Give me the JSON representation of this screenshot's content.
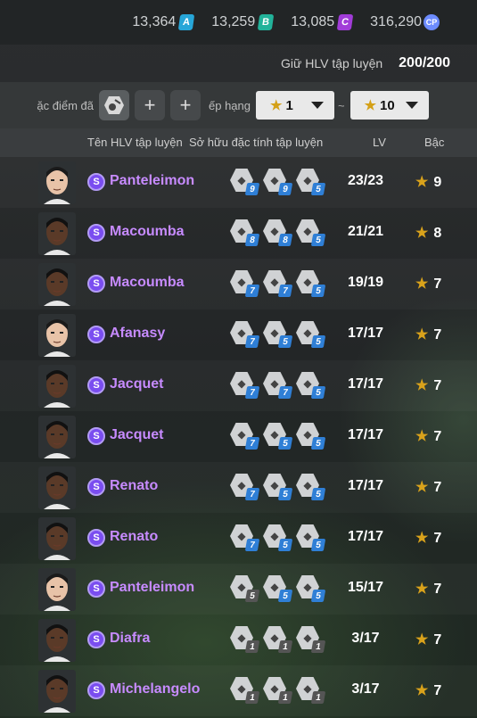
{
  "currencies": [
    {
      "value": "13,364",
      "badge": "A",
      "color": "#27a6d8",
      "icon": "a-coin-icon"
    },
    {
      "value": "13,259",
      "badge": "B",
      "color": "#22b39a",
      "icon": "b-coin-icon"
    },
    {
      "value": "13,085",
      "badge": "C",
      "color": "#a13cd8",
      "icon": "c-coin-icon"
    },
    {
      "value": "316,290",
      "badge": "CP",
      "color": "#6d8cff",
      "icon": "cp-coin-icon"
    }
  ],
  "coach_slots": {
    "label": "Giữ HLV tập luyện",
    "value": "200/200"
  },
  "filter": {
    "trait_label": "ặc điểm đã",
    "rank_label": "ếp hạng",
    "rank_from": "1",
    "rank_to": "10",
    "separator": "~"
  },
  "columns": {
    "name": "Tên HLV tập luyện",
    "traits": "Sở hữu đặc tính tập luyện",
    "lv": "LV",
    "rank": "Bậc"
  },
  "rows": [
    {
      "name": "Panteleimon",
      "face": "light",
      "lv": "23/23",
      "rank": "9",
      "traits": [
        {
          "icon": "shoot-trait-icon",
          "n": "9",
          "c": "#2f7fd6"
        },
        {
          "icon": "pass-trait-icon",
          "n": "9",
          "c": "#2f7fd6"
        },
        {
          "icon": "dribble-trait-icon",
          "n": "5",
          "c": "#2f7fd6"
        }
      ]
    },
    {
      "name": "Macoumba",
      "face": "dark",
      "lv": "21/21",
      "rank": "8",
      "traits": [
        {
          "icon": "keeper-trait-icon",
          "n": "8",
          "c": "#2f7fd6"
        },
        {
          "icon": "pass-trait-icon",
          "n": "8",
          "c": "#2f7fd6"
        },
        {
          "icon": "dribble-trait-icon",
          "n": "5",
          "c": "#2f7fd6"
        }
      ]
    },
    {
      "name": "Macoumba",
      "face": "dark",
      "lv": "19/19",
      "rank": "7",
      "traits": [
        {
          "icon": "defend-trait-icon",
          "n": "7",
          "c": "#2f7fd6"
        },
        {
          "icon": "pass-trait-icon",
          "n": "7",
          "c": "#2f7fd6"
        },
        {
          "icon": "dribble-trait-icon",
          "n": "5",
          "c": "#2f7fd6"
        }
      ]
    },
    {
      "name": "Afanasy",
      "face": "light",
      "lv": "17/17",
      "rank": "7",
      "traits": [
        {
          "icon": "strength-trait-icon",
          "n": "7",
          "c": "#2f7fd6"
        },
        {
          "icon": "dribble-trait-icon",
          "n": "5",
          "c": "#2f7fd6"
        },
        {
          "icon": "tactic-trait-icon",
          "n": "5",
          "c": "#2f7fd6"
        }
      ]
    },
    {
      "name": "Jacquet",
      "face": "dark",
      "lv": "17/17",
      "rank": "7",
      "traits": [
        {
          "icon": "strength-trait-icon",
          "n": "7",
          "c": "#2f7fd6"
        },
        {
          "icon": "lock-trait-icon",
          "n": "7",
          "c": "#2f7fd6"
        },
        {
          "icon": "dribble-trait-icon",
          "n": "5",
          "c": "#2f7fd6"
        }
      ]
    },
    {
      "name": "Jacquet",
      "face": "dark",
      "lv": "17/17",
      "rank": "7",
      "traits": [
        {
          "icon": "strength-trait-icon",
          "n": "7",
          "c": "#2f7fd6"
        },
        {
          "icon": "dribble-trait-icon",
          "n": "5",
          "c": "#2f7fd6"
        },
        {
          "icon": "header-trait-icon",
          "n": "5",
          "c": "#2f7fd6"
        }
      ]
    },
    {
      "name": "Renato",
      "face": "dark",
      "lv": "17/17",
      "rank": "7",
      "traits": [
        {
          "icon": "strength-trait-icon",
          "n": "7",
          "c": "#2f7fd6"
        },
        {
          "icon": "dribble-trait-icon",
          "n": "5",
          "c": "#2f7fd6"
        },
        {
          "icon": "tactic-trait-icon",
          "n": "5",
          "c": "#2f7fd6"
        }
      ]
    },
    {
      "name": "Renato",
      "face": "dark",
      "lv": "17/17",
      "rank": "7",
      "traits": [
        {
          "icon": "strength-trait-icon",
          "n": "7",
          "c": "#2f7fd6"
        },
        {
          "icon": "stamina-trait-icon",
          "n": "5",
          "c": "#2f7fd6"
        },
        {
          "icon": "dribble-trait-icon",
          "n": "5",
          "c": "#2f7fd6"
        }
      ]
    },
    {
      "name": "Panteleimon",
      "face": "light",
      "lv": "15/17",
      "rank": "7",
      "traits": [
        {
          "icon": "strength-trait-icon",
          "n": "5",
          "c": "#555"
        },
        {
          "icon": "stamina-trait-icon",
          "n": "5",
          "c": "#2f7fd6"
        },
        {
          "icon": "tactic-trait-icon",
          "n": "5",
          "c": "#2f7fd6"
        }
      ]
    },
    {
      "name": "Diafra",
      "face": "dark",
      "lv": "3/17",
      "rank": "7",
      "traits": [
        {
          "icon": "strength-trait-icon",
          "n": "1",
          "c": "#555"
        },
        {
          "icon": "dribble-trait-icon",
          "n": "1",
          "c": "#555"
        },
        {
          "icon": "tactic-trait-icon",
          "n": "1",
          "c": "#555"
        }
      ]
    },
    {
      "name": "Michelangelo",
      "face": "dark",
      "lv": "3/17",
      "rank": "7",
      "traits": [
        {
          "icon": "strength-trait-icon",
          "n": "1",
          "c": "#555"
        },
        {
          "icon": "stamina-trait-icon",
          "n": "1",
          "c": "#555"
        },
        {
          "icon": "dribble-trait-icon",
          "n": "1",
          "c": "#555"
        }
      ]
    }
  ]
}
